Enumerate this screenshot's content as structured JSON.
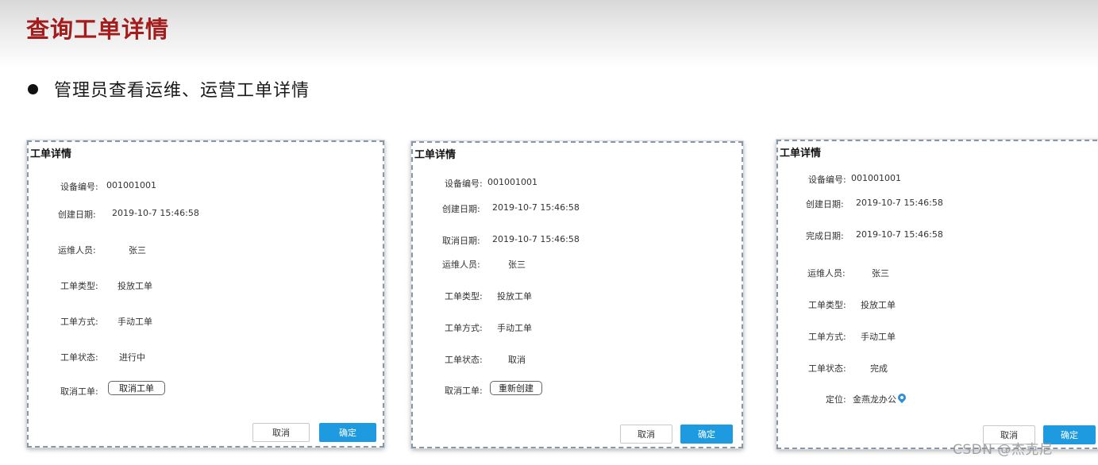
{
  "header": {
    "title": "查询工单详情",
    "bullet": "管理员查看运维、运营工单详情"
  },
  "dialogs": [
    {
      "title": "工单详情",
      "fields": {
        "device_no": {
          "label": "设备编号:",
          "value": "001001001"
        },
        "created": {
          "label": "创建日期:",
          "value": "2019-10-7 15:46:58"
        },
        "staff": {
          "label": "运维人员:",
          "value": "张三"
        },
        "type": {
          "label": "工单类型:",
          "value": "投放工单"
        },
        "method": {
          "label": "工单方式:",
          "value": "手动工单"
        },
        "status": {
          "label": "工单状态:",
          "value": "进行中"
        },
        "action": {
          "label": "取消工单:",
          "button": "取消工单"
        }
      },
      "buttons": {
        "cancel": "取消",
        "ok": "确定"
      }
    },
    {
      "title": "工单详情",
      "fields": {
        "device_no": {
          "label": "设备编号:",
          "value": "001001001"
        },
        "created": {
          "label": "创建日期:",
          "value": "2019-10-7 15:46:58"
        },
        "cancelled": {
          "label": "取消日期:",
          "value": "2019-10-7 15:46:58"
        },
        "staff": {
          "label": "运维人员:",
          "value": "张三"
        },
        "type": {
          "label": "工单类型:",
          "value": "投放工单"
        },
        "method": {
          "label": "工单方式:",
          "value": "手动工单"
        },
        "status": {
          "label": "工单状态:",
          "value": "取消"
        },
        "action": {
          "label": "取消工单:",
          "button": "重新创建"
        }
      },
      "buttons": {
        "cancel": "取消",
        "ok": "确定"
      }
    },
    {
      "title": "工单详情",
      "fields": {
        "device_no": {
          "label": "设备编号:",
          "value": "001001001"
        },
        "created": {
          "label": "创建日期:",
          "value": "2019-10-7 15:46:58"
        },
        "completed": {
          "label": "完成日期:",
          "value": "2019-10-7 15:46:58"
        },
        "staff": {
          "label": "运维人员:",
          "value": "张三"
        },
        "type": {
          "label": "工单类型:",
          "value": "投放工单"
        },
        "method": {
          "label": "工单方式:",
          "value": "手动工单"
        },
        "status": {
          "label": "工单状态:",
          "value": "完成"
        },
        "location": {
          "label": "定位:",
          "value": "金燕龙办公",
          "icon": "location-pin-icon"
        }
      },
      "buttons": {
        "cancel": "取消",
        "ok": "确定"
      }
    }
  ],
  "watermark": "CSDN @杰克尼",
  "colors": {
    "title": "#a51c1c",
    "primary": "#1e9be0",
    "pin": "#2f8fd8"
  }
}
